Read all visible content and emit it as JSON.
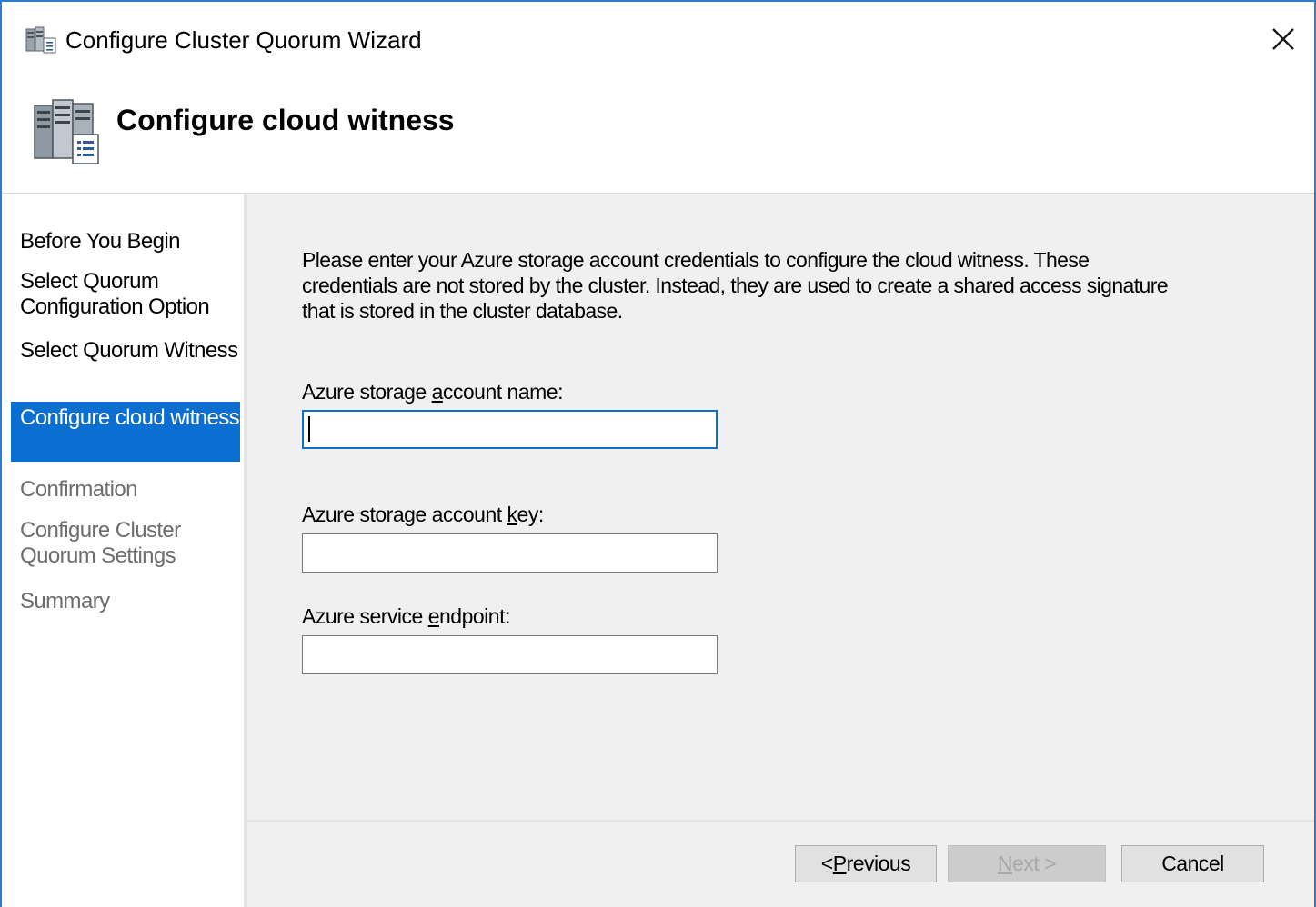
{
  "window": {
    "title": "Configure Cluster Quorum Wizard",
    "accent_color": "#2b7bd3",
    "title_icon": "cluster-wizard-icon",
    "close_icon": "close-icon"
  },
  "header": {
    "title": "Configure cloud witness",
    "icon": "cluster-servers-icon"
  },
  "sidebar": {
    "active_color": "#0a6fd0",
    "steps": [
      {
        "label": "Before You Begin",
        "state": "done"
      },
      {
        "label": "Select Quorum Configuration Option",
        "state": "done"
      },
      {
        "label": "Select Quorum Witness",
        "state": "done"
      },
      {
        "label": "Configure cloud witness",
        "state": "active"
      },
      {
        "label": "Confirmation",
        "state": "pending"
      },
      {
        "label": "Configure Cluster Quorum Settings",
        "state": "pending"
      },
      {
        "label": "Summary",
        "state": "pending"
      }
    ]
  },
  "main": {
    "intro": "Please enter your Azure storage account credentials to configure the cloud witness. These credentials are not stored by the cluster. Instead, they are used to create a shared access signature that is stored in the cluster database.",
    "fields": [
      {
        "label_before": "Azure storage ",
        "label_key": "a",
        "label_after": "ccount name:",
        "value": "",
        "placeholder": ""
      },
      {
        "label_before": "Azure storage account ",
        "label_key": "k",
        "label_after": "ey:",
        "value": "",
        "placeholder": ""
      },
      {
        "label_before": "Azure service ",
        "label_key": "e",
        "label_after": "ndpoint:",
        "value": "",
        "placeholder": ""
      }
    ]
  },
  "footer": {
    "previous": {
      "prefix": "< ",
      "key": "P",
      "rest": "revious",
      "enabled": true
    },
    "next": {
      "prefix": "",
      "key": "N",
      "rest": "ext >",
      "enabled": false
    },
    "cancel": {
      "label": "Cancel",
      "enabled": true
    }
  }
}
